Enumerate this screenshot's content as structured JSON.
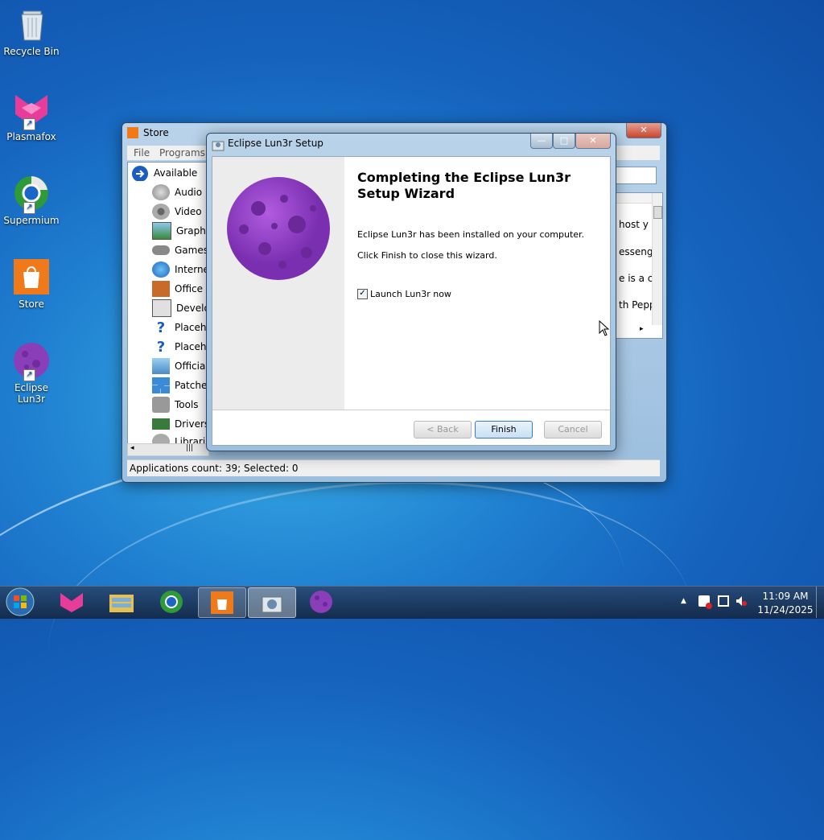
{
  "desktop": {
    "icons": [
      {
        "label": "Recycle Bin",
        "icon": "recycle-bin-icon"
      },
      {
        "label": "Plasmafox",
        "icon": "plasmafox-icon"
      },
      {
        "label": "Supermium",
        "icon": "supermium-icon"
      },
      {
        "label": "Store",
        "icon": "store-icon"
      },
      {
        "label": "Eclipse Lun3r",
        "icon": "eclipse-lun3r-icon"
      }
    ]
  },
  "store_window": {
    "title": "Store",
    "menu": [
      "File",
      "Programs"
    ],
    "tree_root": "Available",
    "categories": [
      "Audio",
      "Video",
      "Graphi",
      "Games",
      "Interne",
      "Office",
      "Develo",
      "Placeh",
      "Placeh",
      "Officia",
      "Patche",
      "Tools",
      "Drivers",
      "Librari"
    ],
    "right_snippets": [
      "host y",
      "esseng",
      "e is a c",
      "th Pepp"
    ],
    "status": "Applications count: 39; Selected: 0",
    "hscroll_grip": "|||"
  },
  "setup_dialog": {
    "title": "Eclipse Lun3r Setup",
    "heading": "Completing the Eclipse Lun3r Setup Wizard",
    "line1": "Eclipse Lun3r has been installed on your computer.",
    "line2": "Click Finish to close this wizard.",
    "checkbox_label": "Launch Lun3r now",
    "checkbox_checked": true,
    "buttons": {
      "back": "< Back",
      "finish": "Finish",
      "cancel": "Cancel"
    }
  },
  "taskbar": {
    "apps": [
      "start-orb-icon",
      "plasmafox-icon",
      "file-explorer-icon",
      "supermium-icon",
      "store-icon",
      "setup-icon",
      "eclipse-lun3r-icon"
    ],
    "clock_time": "11:09 AM",
    "clock_date": "11/24/2025",
    "tray_up_arrow": "▲"
  },
  "colors": {
    "accent": "#1f7fd0",
    "purple": "#8a3fb8",
    "store_orange": "#f07a1a"
  }
}
